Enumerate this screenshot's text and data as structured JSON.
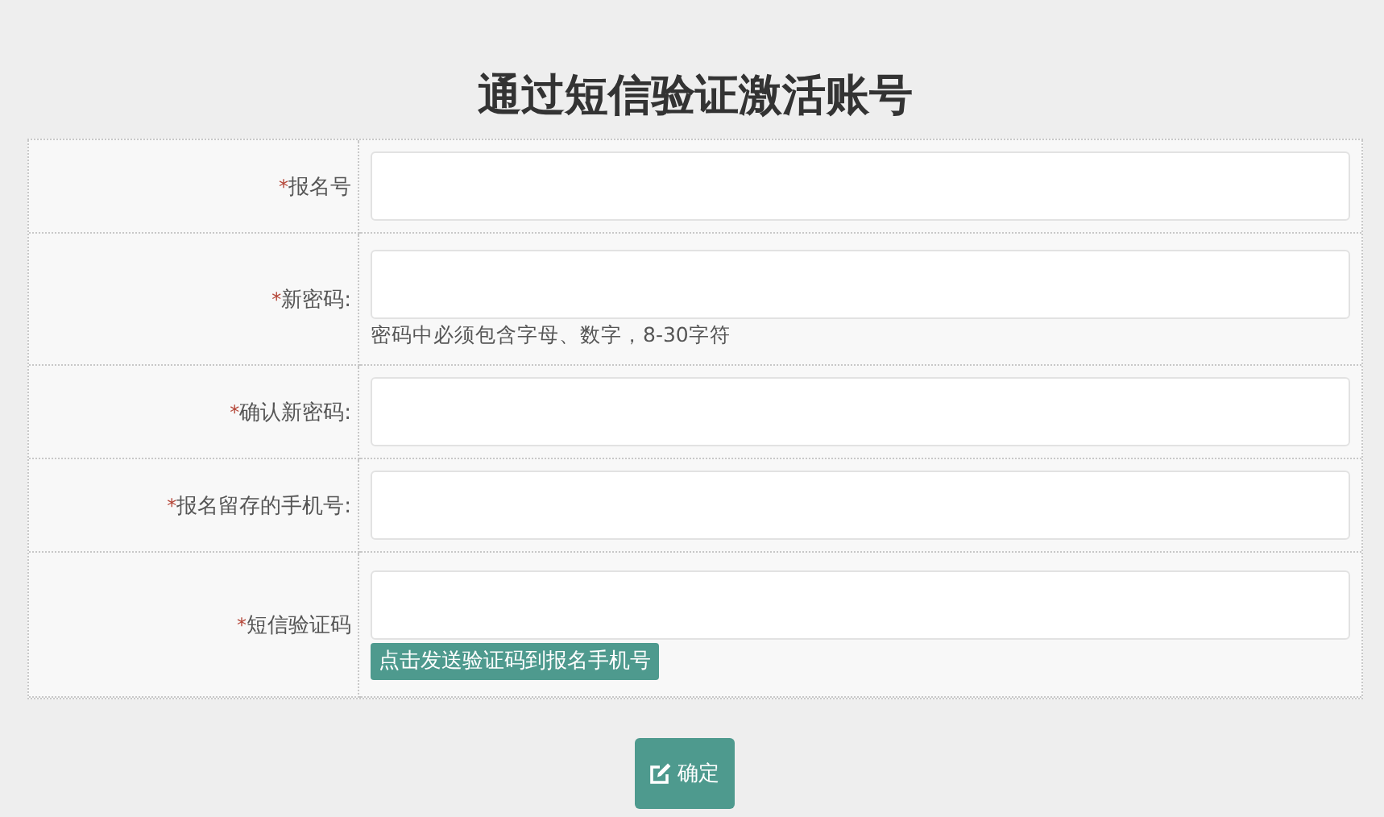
{
  "title": "通过短信验证激活账号",
  "fields": [
    {
      "mark": "*",
      "label": "报名号"
    },
    {
      "mark": "*",
      "label": "新密码:",
      "hint": "密码中必须包含字母、数字，8-30字符"
    },
    {
      "mark": "*",
      "label": "确认新密码:"
    },
    {
      "mark": "*",
      "label": "报名留存的手机号:"
    },
    {
      "mark": "*",
      "label": "短信验证码",
      "action": "点击发送验证码到报名手机号"
    }
  ],
  "submit": {
    "label": "确定"
  }
}
